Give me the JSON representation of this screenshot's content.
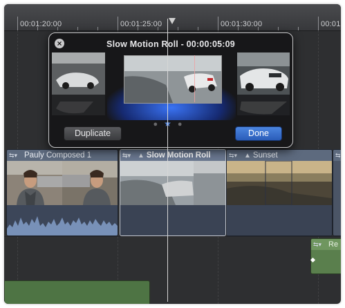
{
  "ruler": {
    "timecodes": [
      "00:01:20:00",
      "00:01:25:00",
      "00:01:30:00",
      "00:01:"
    ]
  },
  "retime_hud": {
    "title": "Slow Motion Roll - 00:00:05:09",
    "close_icon": "close-icon",
    "page_dots": [
      "dot",
      "star",
      "dot"
    ],
    "duplicate_label": "Duplicate",
    "done_label": "Done"
  },
  "clips": [
    {
      "name": "Pauly Composed 1",
      "selected": false
    },
    {
      "name": "Slow Motion Roll",
      "selected": true
    },
    {
      "name": "Sunset",
      "selected": false
    },
    {
      "name": "",
      "selected": false
    }
  ],
  "connected_clip": {
    "name": "Re"
  },
  "colors": {
    "timeline_bg": "#2e2f31",
    "clip_video": "#5d6a7e",
    "clip_selected_border": "#c7cbd2",
    "done_button": "#3a70cc",
    "connected_clip": "#5a7f4d"
  }
}
